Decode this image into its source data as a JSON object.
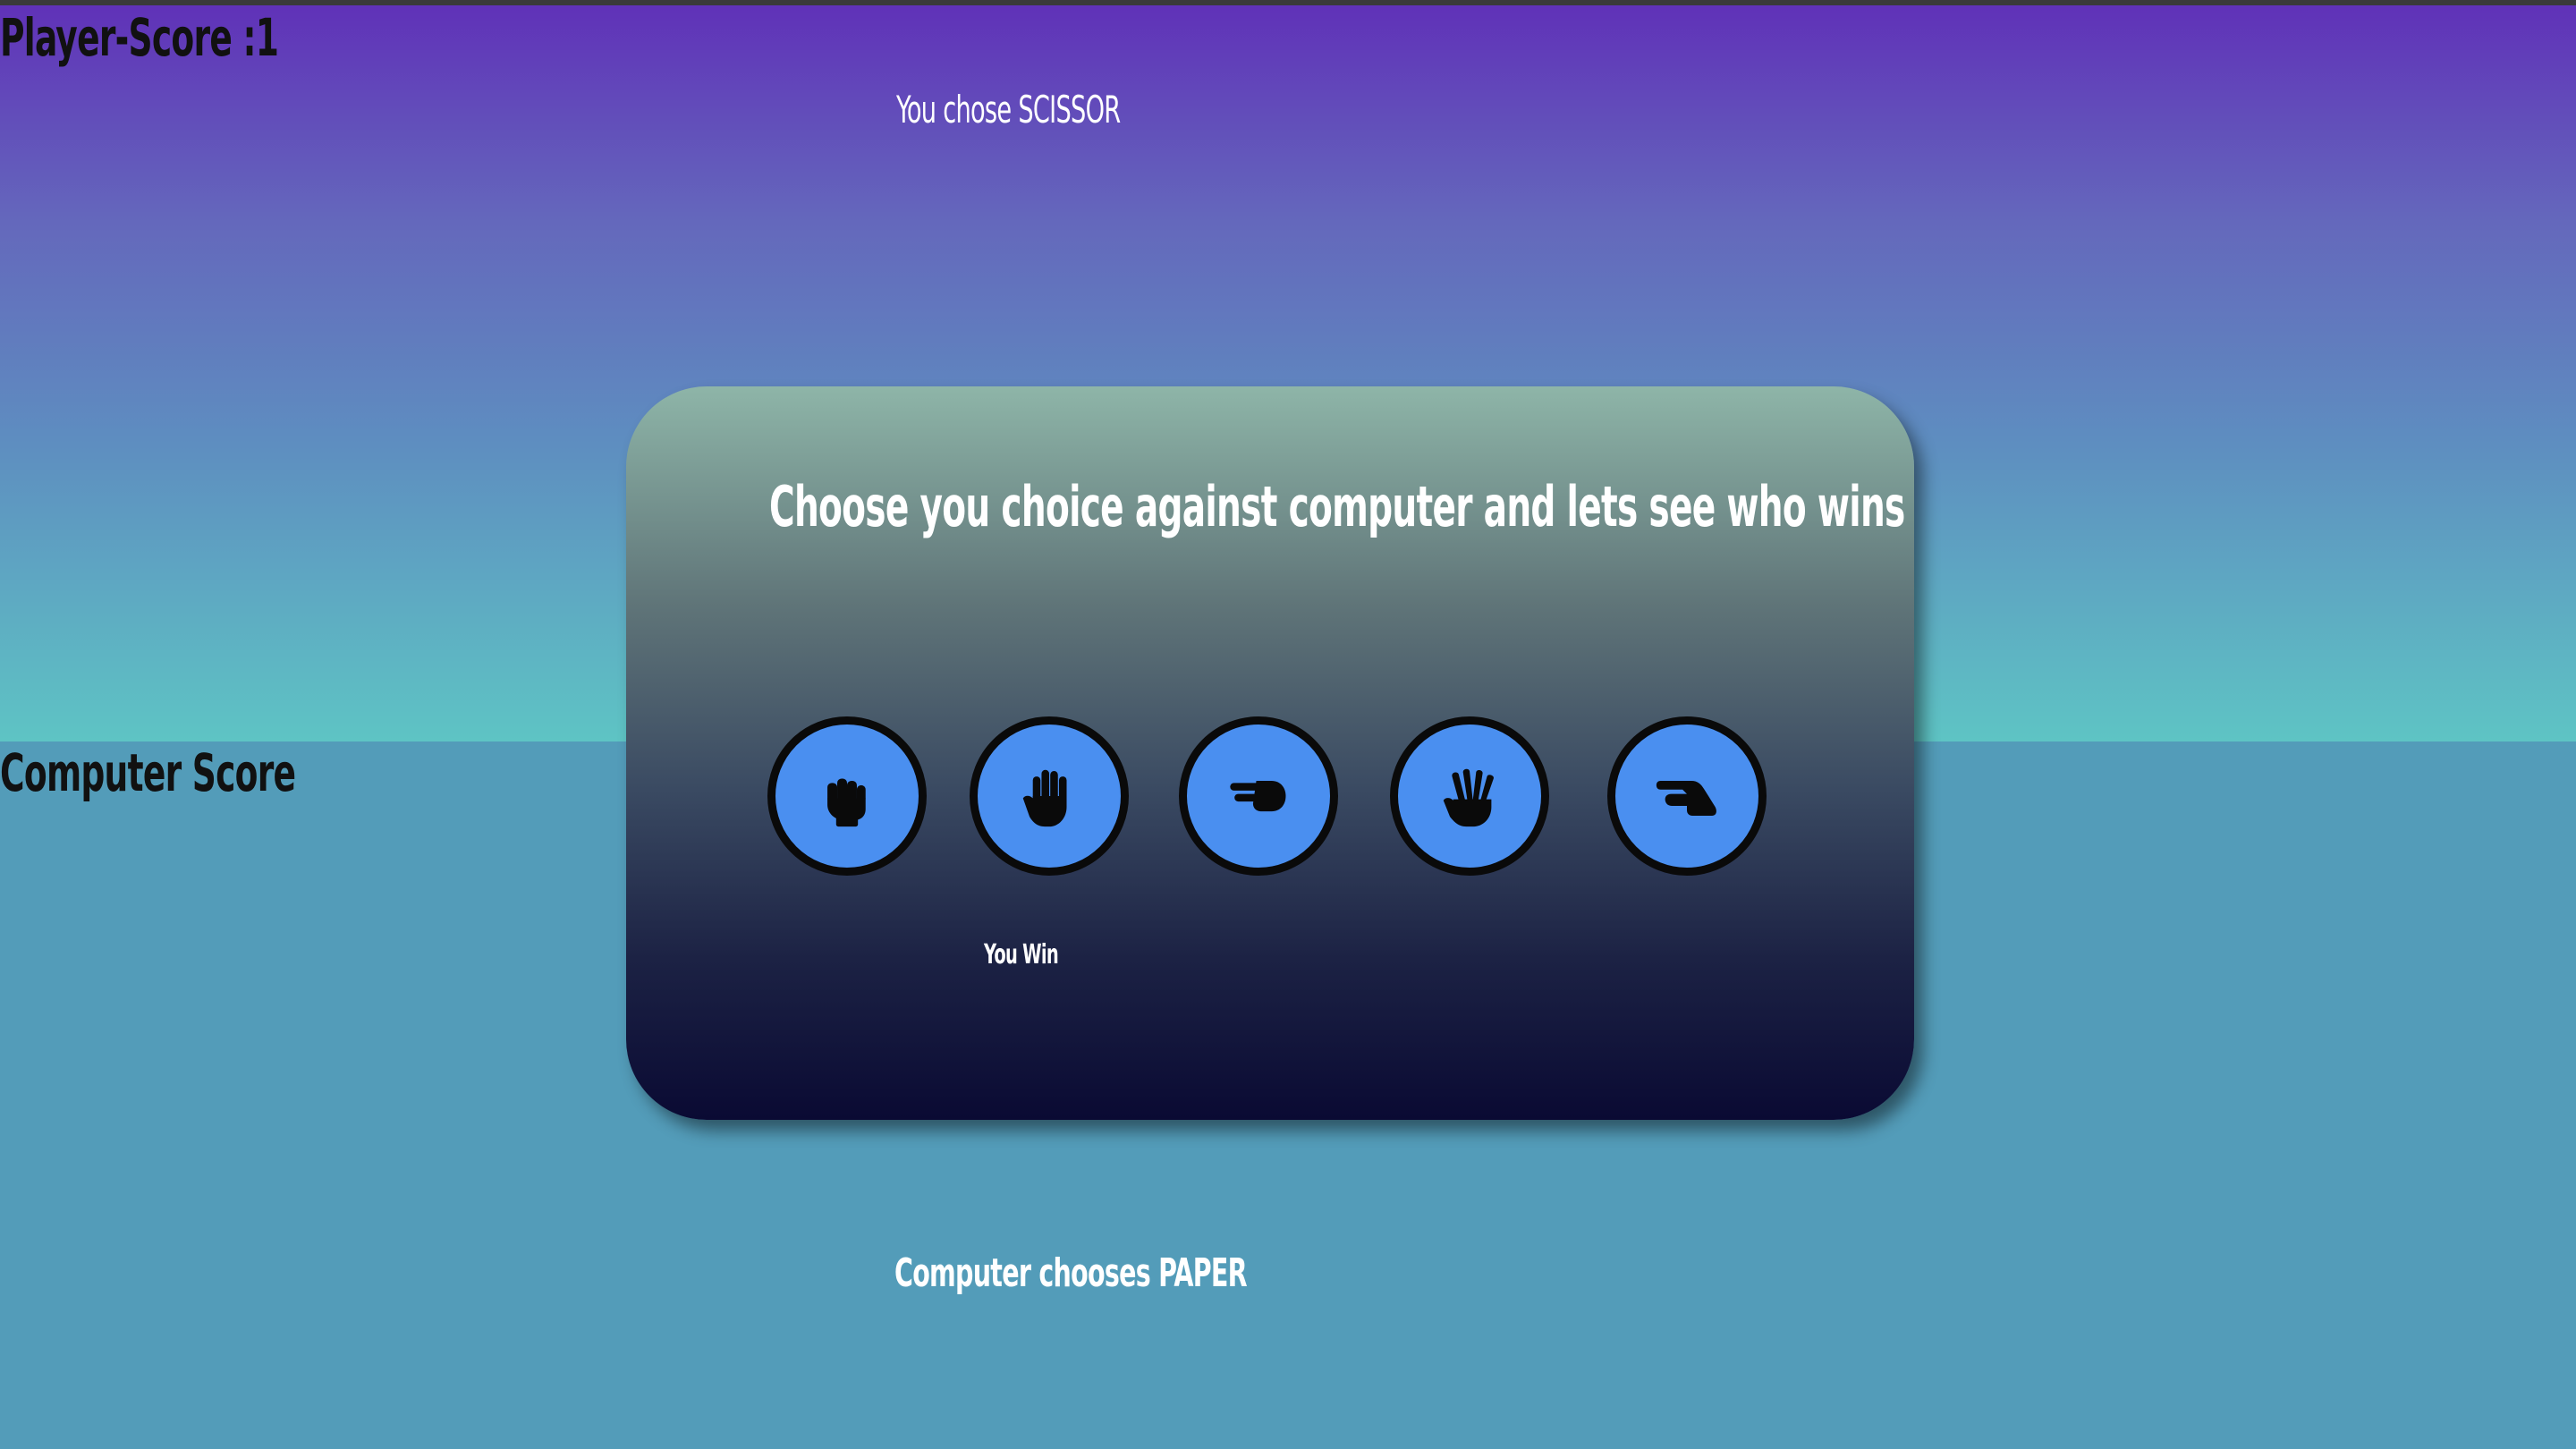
{
  "scores": {
    "player_label": "Player-Score :1",
    "computer_label": "Computer Score"
  },
  "round": {
    "player_choice_text": "You chose SCISSOR",
    "computer_choice_text": "Computer chooses PAPER",
    "result_text": "You Win"
  },
  "card": {
    "title": "Choose you choice against computer and lets see who wins"
  },
  "choices": [
    {
      "name": "rock",
      "icon": "hand-rock-icon"
    },
    {
      "name": "paper",
      "icon": "hand-paper-icon"
    },
    {
      "name": "scissor",
      "icon": "hand-scissors-icon"
    },
    {
      "name": "spock",
      "icon": "hand-spock-icon"
    },
    {
      "name": "lizard",
      "icon": "hand-lizard-icon"
    }
  ],
  "colors": {
    "button_fill": "#4a8ff0",
    "button_border": "#0a0a0a",
    "background_bottom": "#539cb9",
    "background_top": "#6030b8"
  }
}
